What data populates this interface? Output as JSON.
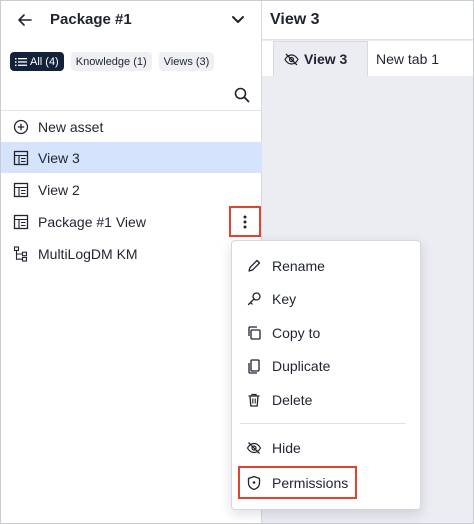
{
  "left_panel": {
    "title": "Package #1",
    "filters": [
      {
        "label": "All (4)",
        "active": true,
        "icon": "list-icon"
      },
      {
        "label": "Knowledge (1)",
        "active": false
      },
      {
        "label": "Views (3)",
        "active": false
      }
    ],
    "items": [
      {
        "label": "New asset",
        "icon": "plus-circle-icon",
        "selected": false
      },
      {
        "label": "View 3",
        "icon": "view-grid-icon",
        "selected": true
      },
      {
        "label": "View 2",
        "icon": "view-grid-icon",
        "selected": false
      },
      {
        "label": "Package #1 View",
        "icon": "view-grid-icon",
        "selected": false
      },
      {
        "label": "MultiLogDM KM",
        "icon": "tree-structure-icon",
        "selected": false
      }
    ]
  },
  "right_panel": {
    "title": "View 3",
    "tabs": [
      {
        "label": "View 3",
        "active": true,
        "icon": "eye-off-icon"
      },
      {
        "label": "New tab 1",
        "active": false
      }
    ]
  },
  "context_menu": {
    "items": [
      {
        "label": "Rename",
        "icon": "pencil-icon"
      },
      {
        "label": "Key",
        "icon": "key-icon"
      },
      {
        "label": "Copy to",
        "icon": "copy-icon"
      },
      {
        "label": "Duplicate",
        "icon": "duplicate-icon"
      },
      {
        "label": "Delete",
        "icon": "trash-icon"
      },
      {
        "label": "Hide",
        "icon": "eye-off-icon"
      },
      {
        "label": "Permissions",
        "icon": "shield-icon"
      }
    ]
  },
  "colors": {
    "selected_row": "#d5e4fc",
    "active_chip": "#13223b",
    "highlight_outline": "#e0442f",
    "right_background": "#ecedf2"
  }
}
